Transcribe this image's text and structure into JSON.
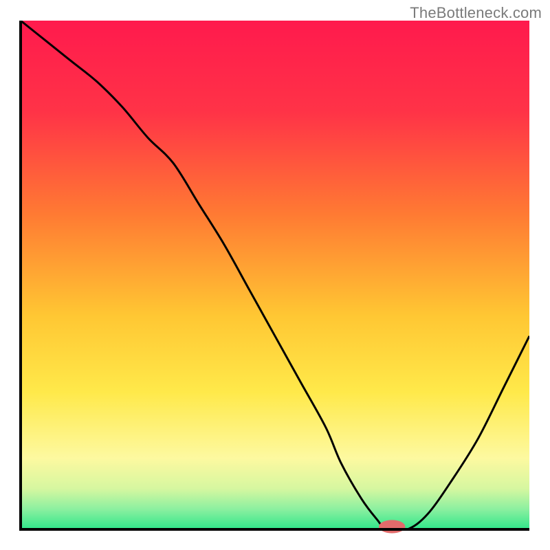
{
  "watermark": "TheBottleneck.com",
  "chart_data": {
    "type": "line",
    "title": "",
    "xlabel": "",
    "ylabel": "",
    "xlim": [
      0,
      100
    ],
    "ylim": [
      0,
      100
    ],
    "grid": false,
    "legend": false,
    "annotations": [],
    "background_gradient": {
      "stops": [
        {
          "pos": 0.0,
          "color": "#ff1a4d"
        },
        {
          "pos": 0.18,
          "color": "#ff3347"
        },
        {
          "pos": 0.38,
          "color": "#ff7a33"
        },
        {
          "pos": 0.58,
          "color": "#ffc733"
        },
        {
          "pos": 0.73,
          "color": "#ffe94a"
        },
        {
          "pos": 0.86,
          "color": "#fdf9a0"
        },
        {
          "pos": 0.92,
          "color": "#d6f7a0"
        },
        {
          "pos": 0.96,
          "color": "#8cf0a0"
        },
        {
          "pos": 1.0,
          "color": "#2fe68a"
        }
      ]
    },
    "series": [
      {
        "name": "bottleneck-curve",
        "color": "#000000",
        "x": [
          0,
          5,
          10,
          15,
          20,
          25,
          30,
          35,
          40,
          45,
          50,
          55,
          60,
          63,
          67,
          70,
          72,
          76,
          80,
          85,
          90,
          95,
          100
        ],
        "y": [
          100,
          96,
          92,
          88,
          83,
          77,
          72,
          64,
          56,
          47,
          38,
          29,
          20,
          13,
          6,
          2,
          0,
          0,
          3,
          10,
          18,
          28,
          38
        ]
      }
    ],
    "marker": {
      "name": "optimal-marker",
      "color": "#e26b6b",
      "x": 73,
      "y": 0,
      "rx": 2.6,
      "ry": 1.3
    },
    "note": "Axis values are percentages of plot extent; no numeric tick labels are visible in the source image."
  }
}
